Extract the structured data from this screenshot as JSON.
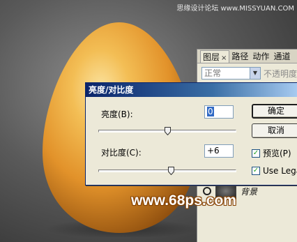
{
  "watermark_top": "思缘设计论坛 www.MISSYUAN.COM",
  "watermark_bottom": "www.68ps.com",
  "layers_panel": {
    "tabs": [
      "图层",
      "路径",
      "动作",
      "通道"
    ],
    "tab_close": "×",
    "blend_mode": "正常",
    "opacity_label": "不透明度",
    "layer_name": "背景"
  },
  "dialog": {
    "title": "亮度/对比度",
    "brightness_label": "亮度(B):",
    "brightness_value": "0",
    "brightness_slider": 0.5,
    "contrast_label": "对比度(C):",
    "contrast_value": "+6",
    "contrast_slider": 0.53,
    "ok_label": "确定",
    "cancel_label": "取消",
    "preview_label": "预览(P)",
    "preview_checked": true,
    "legacy_label": "Use Lega",
    "legacy_checked": true
  },
  "colors": {
    "egg_light": "#f6d27a",
    "egg_mid": "#e79a2a",
    "egg_dark": "#a45d12",
    "title_bar": "#0a246a",
    "dialog_bg": "#ece9d8"
  }
}
